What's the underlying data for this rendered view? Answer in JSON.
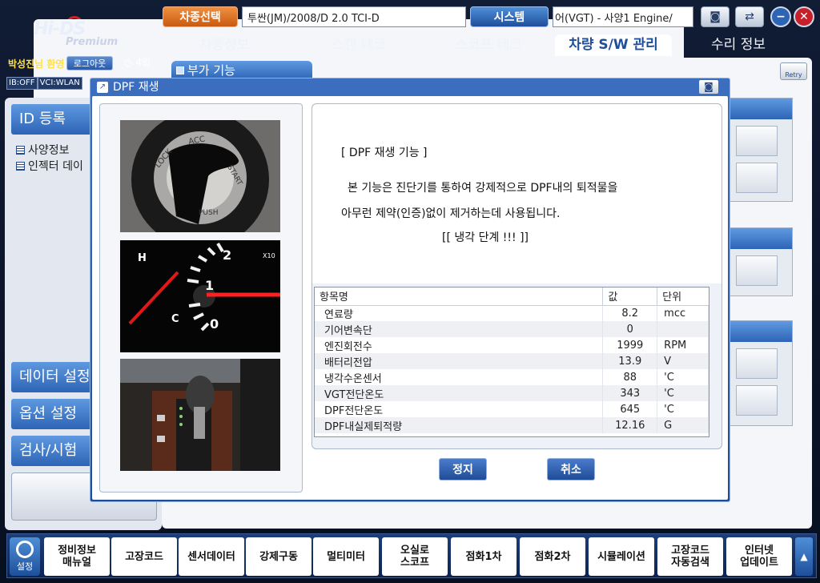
{
  "header": {
    "logo_main": "Hi-DS",
    "logo_sub": "Premium",
    "vehicle_select_label": "차종선택",
    "vehicle_value": "투싼(JM)/2008/D 2.0 TCI-D",
    "system_label": "시스템",
    "spec_value": "어(VGT) - 사양1    Engine/",
    "camera_icon": "camera-icon",
    "switch_icon": "switch-icon",
    "minimize_label": "−",
    "close_label": "✕"
  },
  "nav": {
    "tabs": [
      "차종정보",
      "스캔 테크",
      "스코프 테크",
      "차량 S/W 관리",
      "수리 정보"
    ],
    "active_index": 3
  },
  "status": {
    "user": "박성진님 환영",
    "logout": "로그아웃",
    "clock_text": "4일",
    "ib": "IB:OFF",
    "vci": "VCI:WLAN"
  },
  "left": {
    "id_register": "ID 등록",
    "tree": [
      "사양정보",
      "인젝터 데이"
    ],
    "data_settings": "데이터 설정",
    "option_settings": "옵션 설정",
    "inspect_test": "검사/시험"
  },
  "main": {
    "tab_label": "부가 기능",
    "retry_label": "Retry"
  },
  "dialog": {
    "title": "DPF 재생",
    "line1": "[ DPF 재생 기능 ]",
    "line2": "본 기능은 진단기를 통하여 강제적으로 DPF내의 퇴적물을",
    "line3": "아무런 제약(인증)없이 제거하는데 사용됩니다.",
    "line4": "[[ 냉각 단계 !!! ]]",
    "table_headers": [
      "항목명",
      "값",
      "단위"
    ],
    "rows": [
      {
        "name": "연료량",
        "value": "8.2",
        "unit": "mcc"
      },
      {
        "name": "기어변속단",
        "value": "0",
        "unit": ""
      },
      {
        "name": "엔진회전수",
        "value": "1999",
        "unit": "RPM"
      },
      {
        "name": "배터리전압",
        "value": "13.9",
        "unit": "V"
      },
      {
        "name": "냉각수온센서",
        "value": "88",
        "unit": "'C"
      },
      {
        "name": "VGT전단온도",
        "value": "343",
        "unit": "'C"
      },
      {
        "name": "DPF전단온도",
        "value": "645",
        "unit": "'C"
      },
      {
        "name": "DPF내실제퇴적량",
        "value": "12.16",
        "unit": "G"
      }
    ],
    "stop_label": "정지",
    "cancel_label": "취소",
    "gauge": {
      "h_label": "H",
      "c_label": "C",
      "ticks": [
        "0",
        "1",
        "2"
      ],
      "x10": "X10"
    },
    "ignition": {
      "lock": "LOCK",
      "acc": "ACC",
      "start": "START",
      "push": "PUSH"
    }
  },
  "bottom": {
    "setting_label": "설정",
    "items": [
      "정비정보\n매뉴얼",
      "고장코드",
      "센서데이터",
      "강제구동",
      "멀티미터",
      "오실로\n스코프",
      "점화1차",
      "점화2차",
      "시뮬레이션",
      "고장코드\n자동검색",
      "인터넷\n업데이트"
    ]
  }
}
